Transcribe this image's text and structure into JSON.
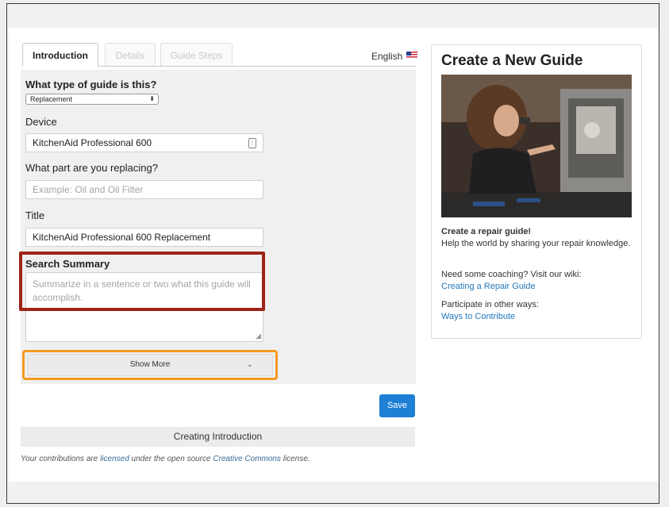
{
  "tabs": [
    {
      "label": "Introduction",
      "state": "active"
    },
    {
      "label": "Details",
      "state": "disabled"
    },
    {
      "label": "Guide Steps",
      "state": "disabled"
    }
  ],
  "language": "English",
  "form": {
    "guide_type_label": "What type of guide is this?",
    "guide_type_value": "Replacement",
    "device_label": "Device",
    "device_value": "KitchenAid Professional 600",
    "part_label": "What part are you replacing?",
    "part_placeholder": "Example: Oil and Oil Filter",
    "title_label": "Title",
    "title_value": "KitchenAid Professional 600  Replacement",
    "summary_label": "Search Summary",
    "summary_placeholder": "Summarize in a sentence or two what this guide will accomplish.",
    "show_more_label": "Show More"
  },
  "save_label": "Save",
  "status_bar": "Creating Introduction",
  "license": {
    "prefix": "Your contributions are ",
    "licensed_link": "licensed",
    "middle": " under the open source ",
    "cc_link": "Creative Commons",
    "suffix": " license."
  },
  "sidebar": {
    "title": "Create a New Guide",
    "heading": "Create a repair guide!",
    "intro": "Help the world by sharing your repair knowledge.",
    "coaching": "Need some coaching? Visit our wiki:",
    "coaching_link": "Creating a Repair Guide",
    "participate": "Participate in other ways:",
    "participate_link": "Ways to Contribute"
  },
  "colors": {
    "accent": "#1f7fd4",
    "highlight_red": "#9e2417",
    "highlight_orange": "#f39a1e",
    "link": "#2277bb"
  }
}
